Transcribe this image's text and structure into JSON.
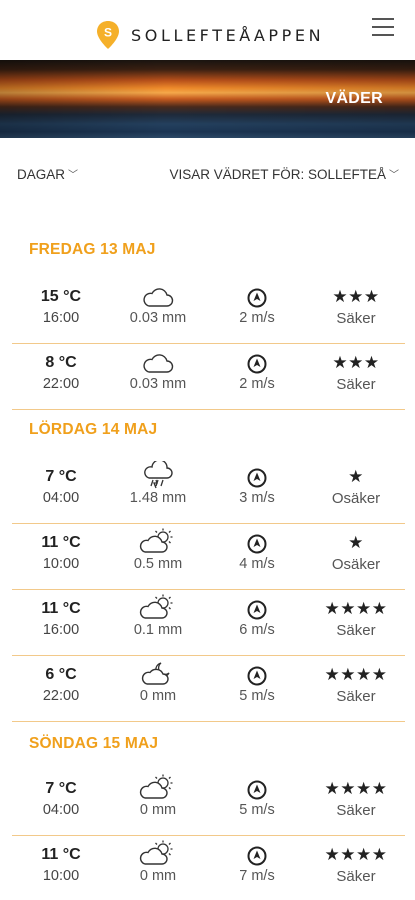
{
  "app": {
    "name": "SOLLEFTEÅAPPEN"
  },
  "banner": {
    "title": "VÄDER"
  },
  "filters": {
    "days_label": "DAGAR",
    "location_label": "VISAR VÄDRET FÖR: SOLLEFTEÅ"
  },
  "days": [
    {
      "heading": "FREDAG 13 MAJ",
      "rows": [
        {
          "temp": "15 °C",
          "time": "16:00",
          "precip": "0.03 mm",
          "wind": "2 m/s",
          "stars": "★★★",
          "reliability": "Säker",
          "weather_icon": "cloud-icon",
          "wind_icon": "wind-direction-icon"
        },
        {
          "temp": "8 °C",
          "time": "22:00",
          "precip": "0.03 mm",
          "wind": "2 m/s",
          "stars": "★★★",
          "reliability": "Säker",
          "weather_icon": "cloud-icon",
          "wind_icon": "wind-direction-icon"
        }
      ]
    },
    {
      "heading": "LÖRDAG 14 MAJ",
      "rows": [
        {
          "temp": "7 °C",
          "time": "04:00",
          "precip": "1.48 mm",
          "wind": "3 m/s",
          "stars": "★",
          "reliability": "Osäker",
          "weather_icon": "rain-cloud-icon",
          "wind_icon": "wind-direction-icon"
        },
        {
          "temp": "11 °C",
          "time": "10:00",
          "precip": "0.5 mm",
          "wind": "4 m/s",
          "stars": "★",
          "reliability": "Osäker",
          "weather_icon": "partly-sunny-icon",
          "wind_icon": "wind-direction-icon"
        },
        {
          "temp": "11 °C",
          "time": "16:00",
          "precip": "0.1 mm",
          "wind": "6 m/s",
          "stars": "★★★★",
          "reliability": "Säker",
          "weather_icon": "partly-sunny-icon",
          "wind_icon": "wind-direction-icon"
        },
        {
          "temp": "6 °C",
          "time": "22:00",
          "precip": "0 mm",
          "wind": "5 m/s",
          "stars": "★★★★",
          "reliability": "Säker",
          "weather_icon": "cloud-moon-icon",
          "wind_icon": "wind-direction-icon"
        }
      ]
    },
    {
      "heading": "SÖNDAG 15 MAJ",
      "rows": [
        {
          "temp": "7 °C",
          "time": "04:00",
          "precip": "0 mm",
          "wind": "5 m/s",
          "stars": "★★★★",
          "reliability": "Säker",
          "weather_icon": "partly-sunny-icon",
          "wind_icon": "wind-direction-icon"
        },
        {
          "temp": "11 °C",
          "time": "10:00",
          "precip": "0 mm",
          "wind": "7 m/s",
          "stars": "★★★★",
          "reliability": "Säker",
          "weather_icon": "partly-sunny-icon",
          "wind_icon": "wind-direction-icon"
        }
      ]
    }
  ]
}
